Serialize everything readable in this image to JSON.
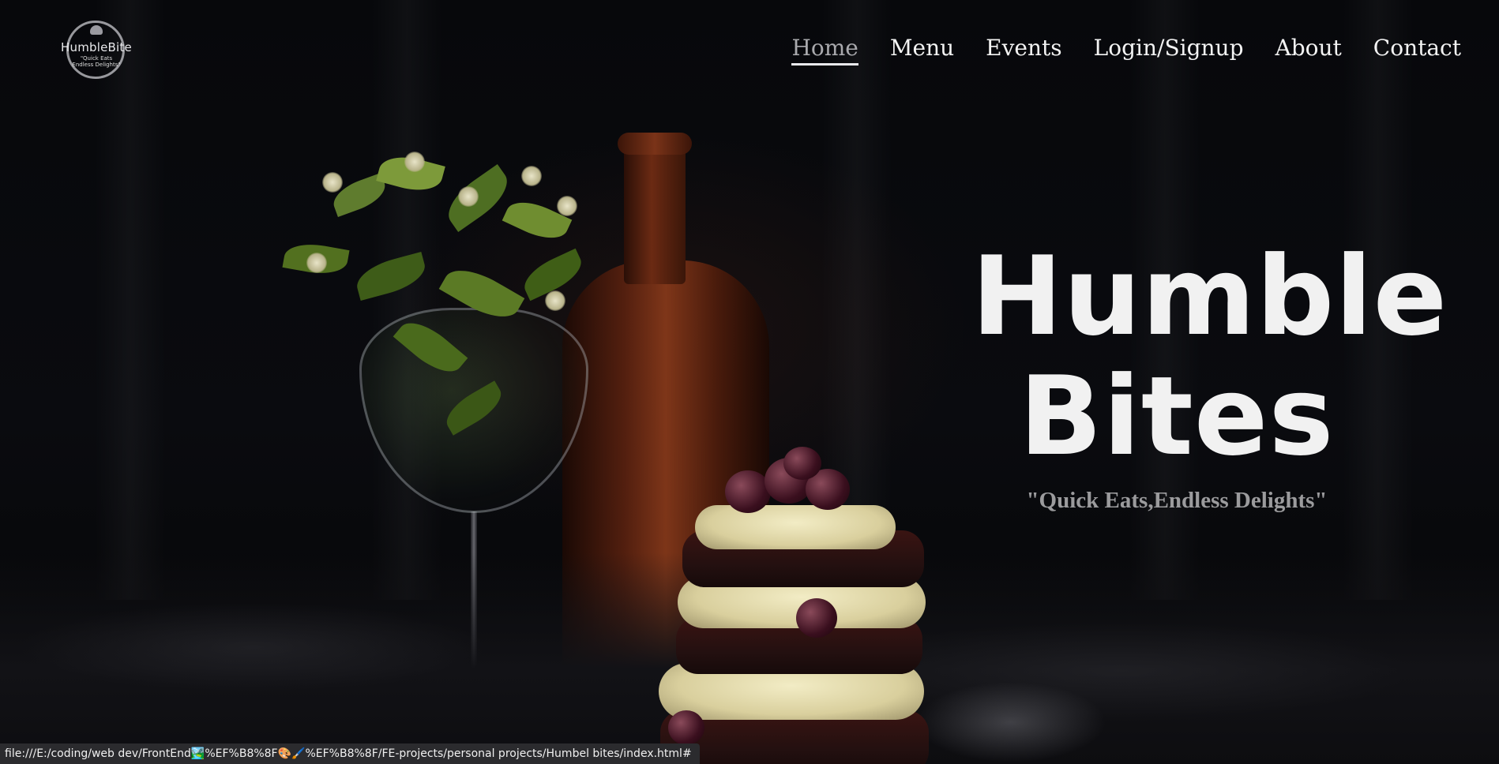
{
  "brand": {
    "logo_text": "HumbleBite",
    "logo_tagline": "\"Quick Eats\nEndless Delights\""
  },
  "nav": {
    "items": [
      {
        "label": "Home",
        "active": true
      },
      {
        "label": "Menu",
        "active": false
      },
      {
        "label": "Events",
        "active": false
      },
      {
        "label": "Login/Signup",
        "active": false
      },
      {
        "label": "About",
        "active": false
      },
      {
        "label": "Contact",
        "active": false
      }
    ]
  },
  "hero": {
    "title_line1": "Humble",
    "title_line2": "Bites",
    "tagline": "\"Quick Eats,Endless Delights\""
  },
  "status_bar": {
    "url": "file:///E:/coding/web dev/FrontEnd🏞️%EF%B8%8F🎨🖌️%EF%B8%8F/FE-projects/personal projects/Humbel bites/index.html#"
  },
  "colors": {
    "background": "#050507",
    "nav_text": "#f3f3f3",
    "nav_active_text": "#a9a9ad",
    "title": "#f1f1f1",
    "tagline": "#9b9b9d"
  },
  "icons": [
    "chef-hat-icon"
  ]
}
